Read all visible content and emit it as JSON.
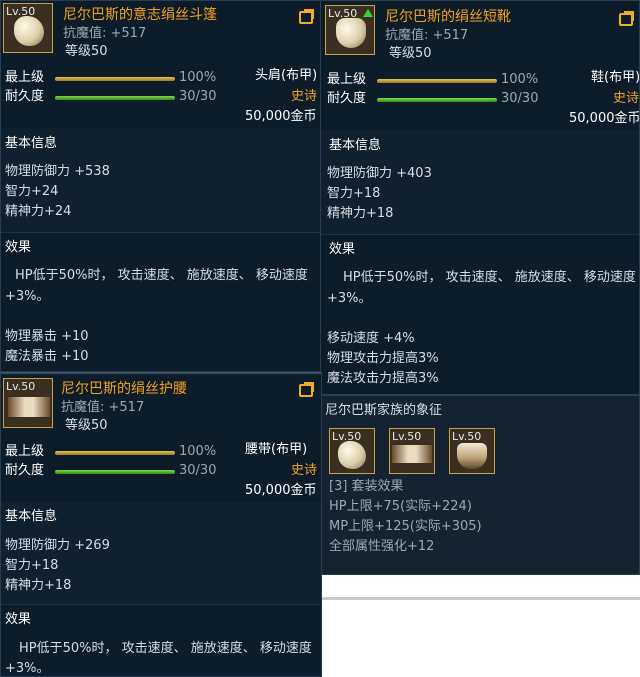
{
  "labels": {
    "max_level": "最上级",
    "durability": "耐久度",
    "basic_info": "基本信息",
    "effect": "效果",
    "set_effect_label": "[3] 套装效果"
  },
  "items": [
    {
      "level": "Lv.50",
      "name": "尼尔巴斯的意志绢丝斗篷",
      "resist": "抗魔值: +517",
      "level_req": "等级50",
      "max_level_pct": "100%",
      "durability": "30/30",
      "slot": "头肩(布甲)",
      "rarity": "史诗",
      "price": "50,000金币",
      "stats": [
        "物理防御力 +538",
        "智力+24",
        "精神力+24"
      ],
      "effect": "HP低于50%时， 攻击速度、 施放速度、 移动速度",
      "effect2": "+3%。",
      "extra": [
        "物理暴击 +10",
        "魔法暴击 +10"
      ]
    },
    {
      "level": "Lv.50",
      "name": "尼尔巴斯的绢丝短靴",
      "resist": "抗魔值: +517",
      "level_req": "等级50",
      "max_level_pct": "100%",
      "durability": "30/30",
      "slot": "鞋(布甲)",
      "rarity": "史诗",
      "price": "50,000金币",
      "stats": [
        "物理防御力 +403",
        "智力+18",
        "精神力+18"
      ],
      "effect": "HP低于50%时， 攻击速度、 施放速度、 移动速度",
      "effect2": "+3%。",
      "extra": [
        "移动速度 +4%",
        "物理攻击力提高3%",
        "魔法攻击力提高3%"
      ]
    },
    {
      "level": "Lv.50",
      "name": "尼尔巴斯的绢丝护腰",
      "resist": "抗魔值: +517",
      "level_req": "等级50",
      "max_level_pct": "100%",
      "durability": "30/30",
      "slot": "腰带(布甲)",
      "rarity": "史诗",
      "price": "50,000金币",
      "stats": [
        "物理防御力 +269",
        "智力+18",
        "精神力+18"
      ],
      "effect": "HP低于50%时， 攻击速度、 施放速度、 移动速度",
      "effect2": "+3%。"
    }
  ],
  "set": {
    "title": "尼尔巴斯家族的象征",
    "icons": [
      "Lv.50",
      "Lv.50",
      "Lv.50"
    ],
    "bonuses": [
      "HP上限+75(实际+224)",
      "MP上限+125(实际+305)",
      "全部属性强化+12"
    ]
  },
  "icons": {
    "share": "share-icon",
    "upgrade": "upgrade-arrow-icon"
  },
  "colors": {
    "panel_bg": "#0d1c29",
    "epic": "#f5a020",
    "durability_bar": "#4caf24",
    "max_level_bar": "#d4af37"
  }
}
